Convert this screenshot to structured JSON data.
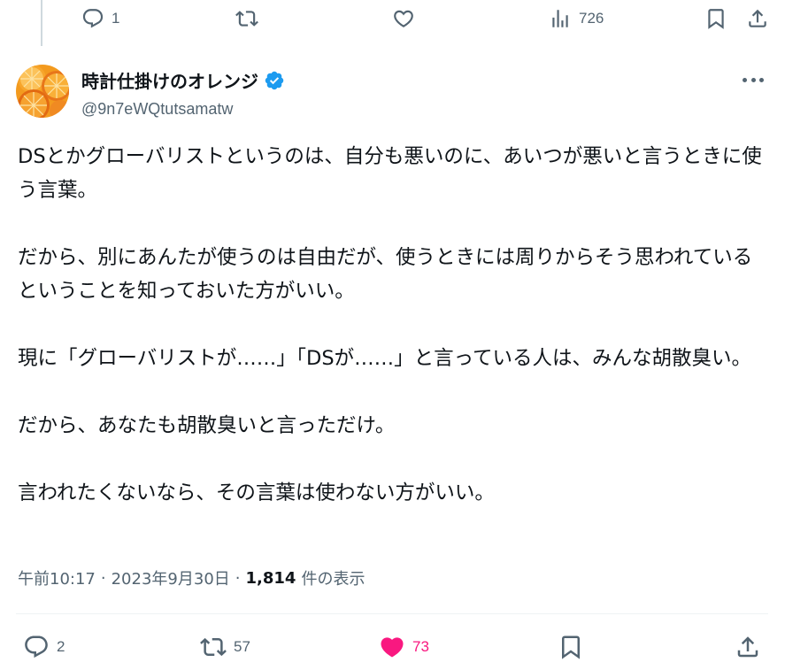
{
  "previous_tweet": {
    "reply_count": "1",
    "views_count": "726"
  },
  "author": {
    "display_name": "時計仕掛けのオレンジ",
    "handle": "@9n7eWQtutsamatw",
    "avatar": "orange-slices-avatar",
    "verified_color": "#1d9bf0"
  },
  "tweet": {
    "paragraphs": [
      "DSとかグローバリストというのは、自分も悪いのに、あいつが悪いと言うときに使う言葉。",
      "だから、別にあんたが使うのは自由だが、使うときには周りからそう思われているということを知っておいた方がいい。",
      "現に「グローバリストが……」「DSが……」と言っている人は、みんな胡散臭い。",
      "だから、あなたも胡散臭いと言っただけ。",
      "言われたくないなら、その言葉は使わない方がいい。"
    ],
    "time": "午前10:17",
    "separator": "·",
    "date": "2023年9月30日",
    "views_count": "1,814",
    "views_label": "件の表示"
  },
  "actions": {
    "reply_count": "2",
    "retweet_count": "57",
    "like_count": "73",
    "like_color": "#f91880"
  },
  "icons": [
    "reply-icon",
    "retweet-icon",
    "like-icon",
    "views-icon",
    "bookmark-icon",
    "share-icon",
    "more-icon",
    "verified-icon"
  ]
}
